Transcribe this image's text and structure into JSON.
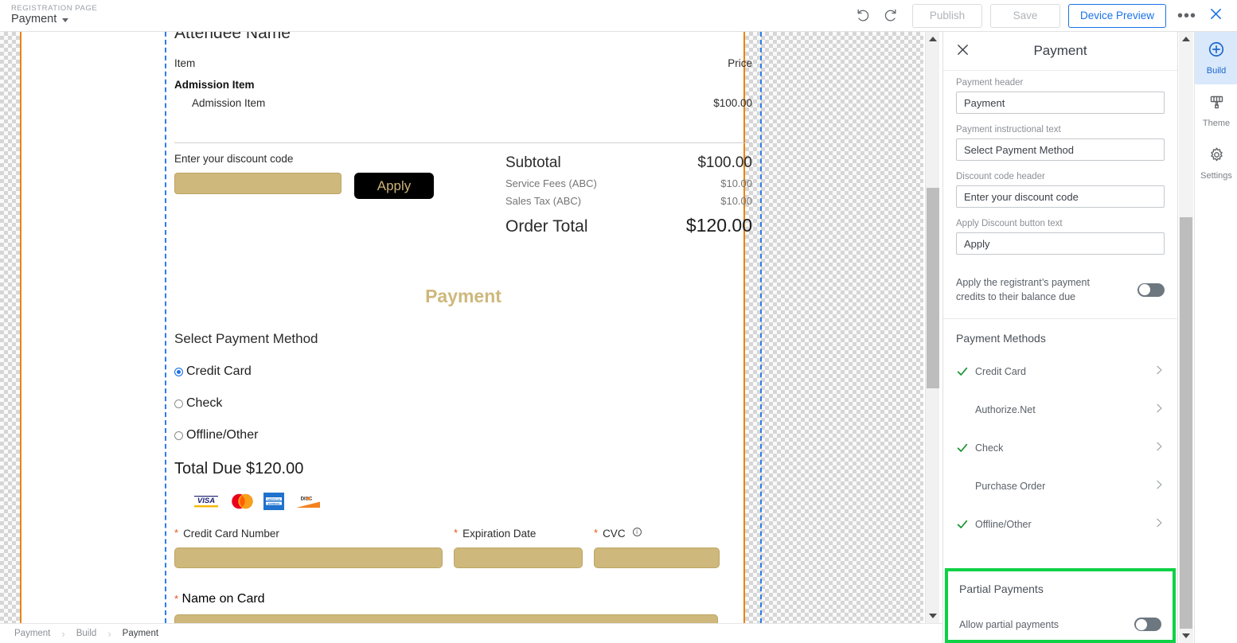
{
  "topbar": {
    "eyebrow": "REGISTRATION PAGE",
    "page_name": "Payment",
    "undo_icon": "undo-icon",
    "redo_icon": "redo-icon",
    "publish_label": "Publish",
    "save_label": "Save",
    "device_preview_label": "Device Preview",
    "overflow_label": "•••",
    "close_icon": "close-icon",
    "accent_blue": "#1a73e8"
  },
  "canvas": {
    "attendee_name": "Attendee Name",
    "items": {
      "col_item": "Item",
      "col_price": "Price",
      "group_label": "Admission Item",
      "rows": [
        {
          "label": "Admission Item",
          "price": "$100.00"
        }
      ]
    },
    "discount": {
      "label": "Enter your discount code",
      "value": "",
      "apply_label": "Apply"
    },
    "totals": [
      {
        "key": "Subtotal",
        "value": "$100.00",
        "style": "sub"
      },
      {
        "key": "Service Fees (ABC)",
        "value": "$10.00",
        "style": "small"
      },
      {
        "key": "Sales Tax (ABC)",
        "value": "$10.00",
        "style": "small"
      },
      {
        "key": "Order Total",
        "value": "$120.00",
        "style": "grand"
      }
    ],
    "payment_title": "Payment",
    "select_method_label": "Select Payment Method",
    "methods": [
      {
        "label": "Credit Card",
        "selected": true
      },
      {
        "label": "Check",
        "selected": false
      },
      {
        "label": "Offline/Other",
        "selected": false
      }
    ],
    "total_due": "Total Due $120.00",
    "card_logos": [
      "visa-logo",
      "mastercard-logo",
      "amex-logo",
      "discover-logo"
    ],
    "cc_number_label": "Credit Card Number",
    "cc_number_value": "",
    "cc_exp_label": "Expiration Date",
    "cc_exp_value": "",
    "cc_cvc_label": "CVC",
    "cc_cvc_value": "",
    "cc_name_label": "Name on Card",
    "cc_name_value": "",
    "required_marker": "*",
    "field_color": "#ceb87c",
    "accent_gold": "#ceb87c"
  },
  "panel": {
    "title": "Payment",
    "close_icon": "close-icon",
    "fields": [
      {
        "label": "Payment header",
        "value": "Payment"
      },
      {
        "label": "Payment instructional text",
        "value": "Select Payment Method"
      },
      {
        "label": "Discount code header",
        "value": "Enter your discount code"
      },
      {
        "label": "Apply Discount button text",
        "value": "Apply"
      }
    ],
    "credits_toggle_label": "Apply the registrant’s payment credits to their balance due",
    "credits_toggle_on": false,
    "payment_methods_title": "Payment Methods",
    "payment_methods": [
      {
        "label": "Credit Card",
        "enabled": true
      },
      {
        "label": "Authorize.Net",
        "enabled": false
      },
      {
        "label": "Check",
        "enabled": true
      },
      {
        "label": "Purchase Order",
        "enabled": false
      },
      {
        "label": "Offline/Other",
        "enabled": true
      }
    ],
    "partial_title": "Partial Payments",
    "partial_toggle_label": "Allow partial payments",
    "partial_toggle_on": false,
    "highlight_color": "#0ed145",
    "check_color": "#1a9431"
  },
  "rail": {
    "items": [
      {
        "label": "Build",
        "icon": "plus-circle-icon",
        "active": true
      },
      {
        "label": "Theme",
        "icon": "paint-roller-icon",
        "active": false
      },
      {
        "label": "Settings",
        "icon": "gear-icon",
        "active": false
      }
    ]
  },
  "breadcrumb": {
    "items": [
      "Payment",
      "Build",
      "Payment"
    ],
    "separator": "›"
  }
}
